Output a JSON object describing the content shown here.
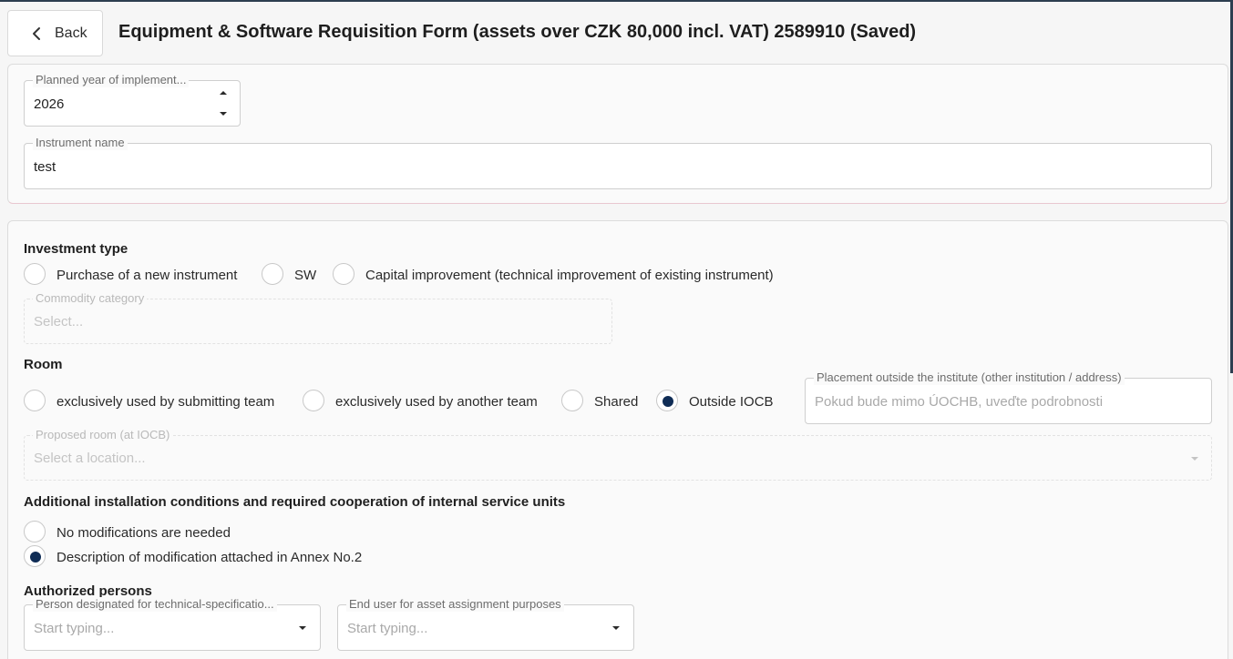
{
  "header": {
    "back_label": "Back",
    "title": "Equipment & Software Requisition Form (assets over CZK 80,000 incl. VAT) 2589910 (Saved)"
  },
  "general": {
    "planned_year": {
      "label": "Planned year of implement...",
      "value": "2026"
    },
    "instrument_name": {
      "label": "Instrument name",
      "value": "test"
    }
  },
  "investment": {
    "title": "Investment type",
    "options": [
      {
        "label": "Purchase of a new instrument",
        "selected": false
      },
      {
        "label": "SW",
        "selected": false
      },
      {
        "label": "Capital improvement (technical improvement of existing instrument)",
        "selected": false
      }
    ],
    "commodity_category": {
      "label": "Commodity category",
      "placeholder": "Select..."
    }
  },
  "room": {
    "title": "Room",
    "options": [
      {
        "label": "exclusively used by submitting team",
        "selected": false
      },
      {
        "label": "exclusively used by another team",
        "selected": false
      },
      {
        "label": "Shared",
        "selected": false
      },
      {
        "label": "Outside IOCB",
        "selected": true
      }
    ],
    "placement_outside": {
      "label": "Placement outside the institute (other institution / address)",
      "placeholder": "Pokud bude mimo ÚOCHB, uveďte podrobnosti"
    },
    "proposed_room": {
      "label": "Proposed room (at IOCB)",
      "placeholder": "Select a location..."
    }
  },
  "installation": {
    "title": "Additional installation conditions and required cooperation of internal service units",
    "options": [
      {
        "label": "No modifications are needed",
        "selected": false
      },
      {
        "label": "Description of modification attached in Annex No.2",
        "selected": true
      }
    ]
  },
  "authorized": {
    "title": "Authorized persons",
    "tech_spec_person": {
      "label": "Person designated for technical-specificatio...",
      "placeholder": "Start typing..."
    },
    "end_user": {
      "label": "End user for asset assignment purposes",
      "placeholder": "Start typing..."
    }
  },
  "colors": {
    "accent": "#0f2c55",
    "topbar": "#2d3e50"
  }
}
